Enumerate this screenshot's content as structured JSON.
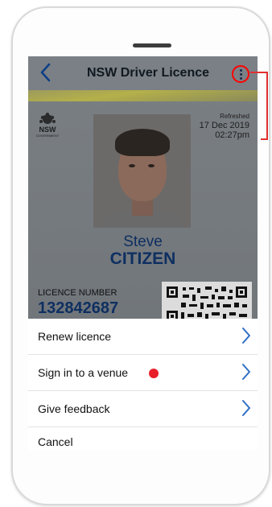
{
  "nav": {
    "title": "NSW Driver Licence",
    "back_icon": "chevron-left-icon",
    "menu_icon": "more-vertical-icon"
  },
  "card": {
    "issuer": "NSW",
    "issuer_sub": "GOVERNMENT",
    "refreshed_label": "Refreshed",
    "refreshed_date": "17 Dec 2019",
    "refreshed_time": "02:27pm",
    "first_name": "Steve",
    "last_name": "CITIZEN",
    "licence_label": "LICENCE NUMBER",
    "licence_number": "132842687"
  },
  "sheet": {
    "items": [
      {
        "label": "Renew licence",
        "has_dot": false
      },
      {
        "label": "Sign in to a venue",
        "has_dot": true
      },
      {
        "label": "Give feedback",
        "has_dot": false
      }
    ],
    "cancel_label": "Cancel"
  },
  "colors": {
    "accent": "#0e3f86",
    "name_blue": "#0e2f61",
    "highlight_red": "#ff0000",
    "status_dot": "#e8202a"
  }
}
